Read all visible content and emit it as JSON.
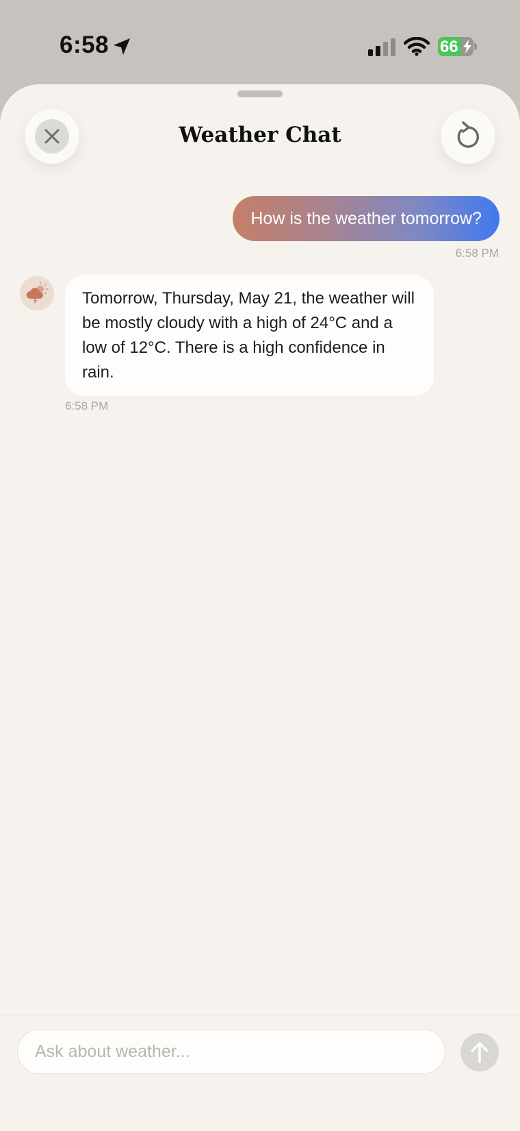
{
  "status_bar": {
    "time": "6:58",
    "battery_level": "66",
    "battery_fraction": 0.66,
    "icons": [
      "location-arrow-icon",
      "cellular-signal-icon",
      "wifi-icon",
      "battery-charging-icon"
    ]
  },
  "header": {
    "title": "Weather Chat",
    "close_icon": "close-icon",
    "reset_icon": "reset-icon"
  },
  "messages": [
    {
      "role": "user",
      "text": "How is the weather tomorrow?",
      "time": "6:58 PM"
    },
    {
      "role": "assistant",
      "avatar_icon": "weather-cloud-sun-lightning-icon",
      "text": "Tomorrow, Thursday, May 21, the weather will be mostly cloudy with a high of 24°C and a low of 12°C. There is a high confidence in rain.",
      "time": "6:58 PM"
    }
  ],
  "composer": {
    "placeholder": "Ask about weather...",
    "value": "",
    "send_icon": "arrow-up-icon"
  },
  "colors": {
    "background": "#f6f2ed",
    "user_bubble_start": "#c47f68",
    "user_bubble_end": "#4279ef",
    "assistant_bubble": "#fefdfb",
    "accent": "#c9765a"
  }
}
